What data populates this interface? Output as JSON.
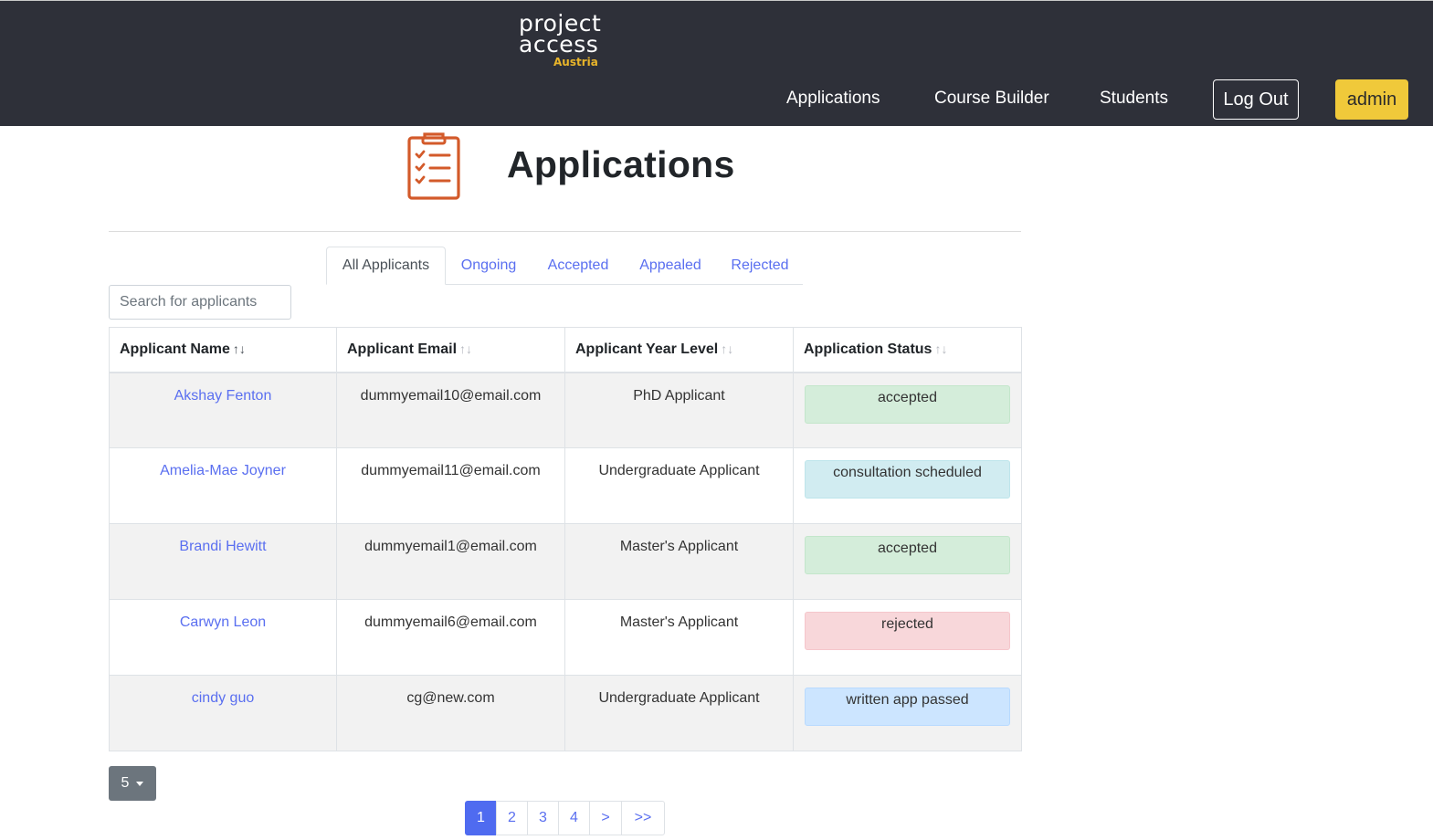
{
  "header": {
    "logo": {
      "line1": "project",
      "line2": "access",
      "line3": "Austria"
    },
    "nav": [
      {
        "label": "Applications"
      },
      {
        "label": "Course Builder"
      },
      {
        "label": "Students"
      }
    ],
    "logout_label": "Log Out",
    "admin_label": "admin"
  },
  "page": {
    "title": "Applications",
    "icon": "clipboard-checklist-icon",
    "accent_color": "#d35a2a"
  },
  "tabs": [
    {
      "label": "All Applicants",
      "active": true
    },
    {
      "label": "Ongoing"
    },
    {
      "label": "Accepted"
    },
    {
      "label": "Appealed"
    },
    {
      "label": "Rejected"
    }
  ],
  "search": {
    "placeholder": "Search for applicants",
    "value": ""
  },
  "table": {
    "columns": [
      {
        "label": "Applicant Name",
        "sort": "↑↓"
      },
      {
        "label": "Applicant Email",
        "sort": "↑↓"
      },
      {
        "label": "Applicant Year Level",
        "sort": "↑↓"
      },
      {
        "label": "Application Status",
        "sort": "↑↓"
      }
    ],
    "rows": [
      {
        "name": "Akshay Fenton",
        "email": "dummyemail10@email.com",
        "year": "PhD Applicant",
        "status": "accepted"
      },
      {
        "name": "Amelia-Mae Joyner",
        "email": "dummyemail11@email.com",
        "year": "Undergraduate Applicant",
        "status": "consultation scheduled"
      },
      {
        "name": "Brandi Hewitt",
        "email": "dummyemail1@email.com",
        "year": "Master's Applicant",
        "status": "accepted"
      },
      {
        "name": "Carwyn Leon",
        "email": "dummyemail6@email.com",
        "year": "Master's Applicant",
        "status": "rejected"
      },
      {
        "name": "cindy guo",
        "email": "cg@new.com",
        "year": "Undergraduate Applicant",
        "status": "written app passed"
      }
    ]
  },
  "page_size": {
    "value": "5"
  },
  "pagination": {
    "items": [
      "1",
      "2",
      "3",
      "4",
      ">",
      ">>"
    ],
    "current": "1"
  },
  "colors": {
    "topbar": "#2e3039",
    "admin_button": "#f0c93a",
    "link": "#5a6ff0",
    "status_accepted": "#d4edda",
    "status_consultation": "#d1ecf1",
    "status_rejected": "#f8d7da",
    "status_written": "#cce5ff"
  }
}
